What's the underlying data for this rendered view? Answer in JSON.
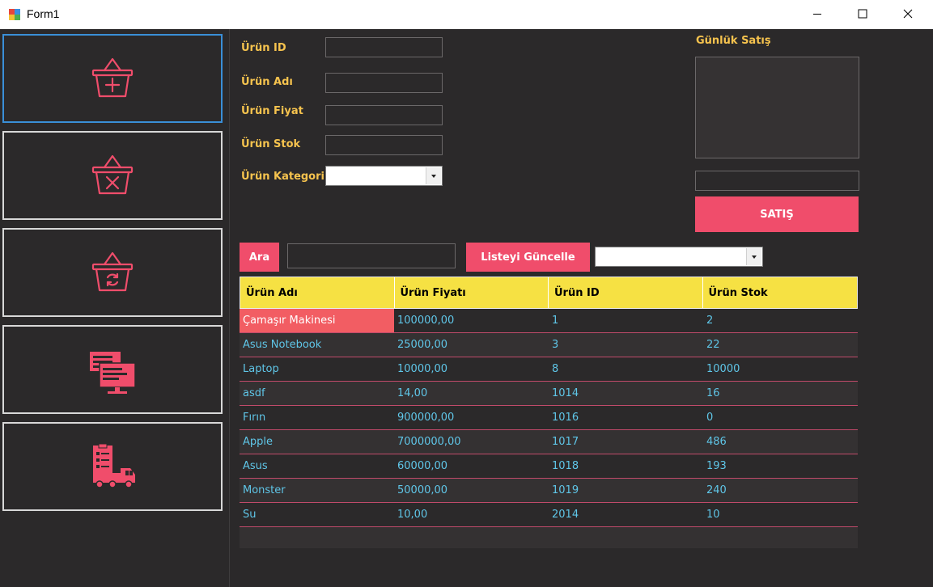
{
  "window": {
    "title": "Form1"
  },
  "sidebar": {
    "items": [
      {
        "icon": "basket-add-icon"
      },
      {
        "icon": "basket-remove-icon"
      },
      {
        "icon": "basket-refresh-icon"
      },
      {
        "icon": "monitor-list-icon"
      },
      {
        "icon": "delivery-truck-icon"
      }
    ]
  },
  "form": {
    "urun_id_label": "Ürün ID",
    "urun_adi_label": "Ürün Adı",
    "urun_fiyat_label": "Ürün Fiyat",
    "urun_stok_label": "Ürün Stok",
    "urun_kategori_label": "Ürün Kategori",
    "urun_id_value": "",
    "urun_adi_value": "",
    "urun_fiyat_value": "",
    "urun_stok_value": "",
    "urun_kategori_value": ""
  },
  "sales": {
    "title": "Günlük Satış",
    "total_value": "",
    "sell_button": "SATIŞ"
  },
  "search": {
    "button": "Ara",
    "value": "",
    "refresh_button": "Listeyi Güncelle",
    "filter_value": ""
  },
  "grid": {
    "columns": [
      "Ürün Adı",
      "Ürün Fiyatı",
      "Ürün ID",
      "Ürün Stok"
    ],
    "rows": [
      [
        "Çamaşır Makinesi",
        "100000,00",
        "1",
        "2"
      ],
      [
        "Asus Notebook",
        "25000,00",
        "3",
        "22"
      ],
      [
        "Laptop",
        "10000,00",
        "8",
        "10000"
      ],
      [
        "asdf",
        "14,00",
        "1014",
        "16"
      ],
      [
        "Fırın",
        "900000,00",
        "1016",
        "0"
      ],
      [
        "Apple",
        "7000000,00",
        "1017",
        "486"
      ],
      [
        "Asus",
        "60000,00",
        "1018",
        "193"
      ],
      [
        "Monster",
        "50000,00",
        "1019",
        "240"
      ],
      [
        "Su",
        "10,00",
        "2014",
        "10"
      ]
    ]
  },
  "colors": {
    "accent": "#f04d6b",
    "label": "#f6c34e",
    "header": "#f6e143",
    "cell_text": "#5fc6e8",
    "background": "#2b292a"
  }
}
